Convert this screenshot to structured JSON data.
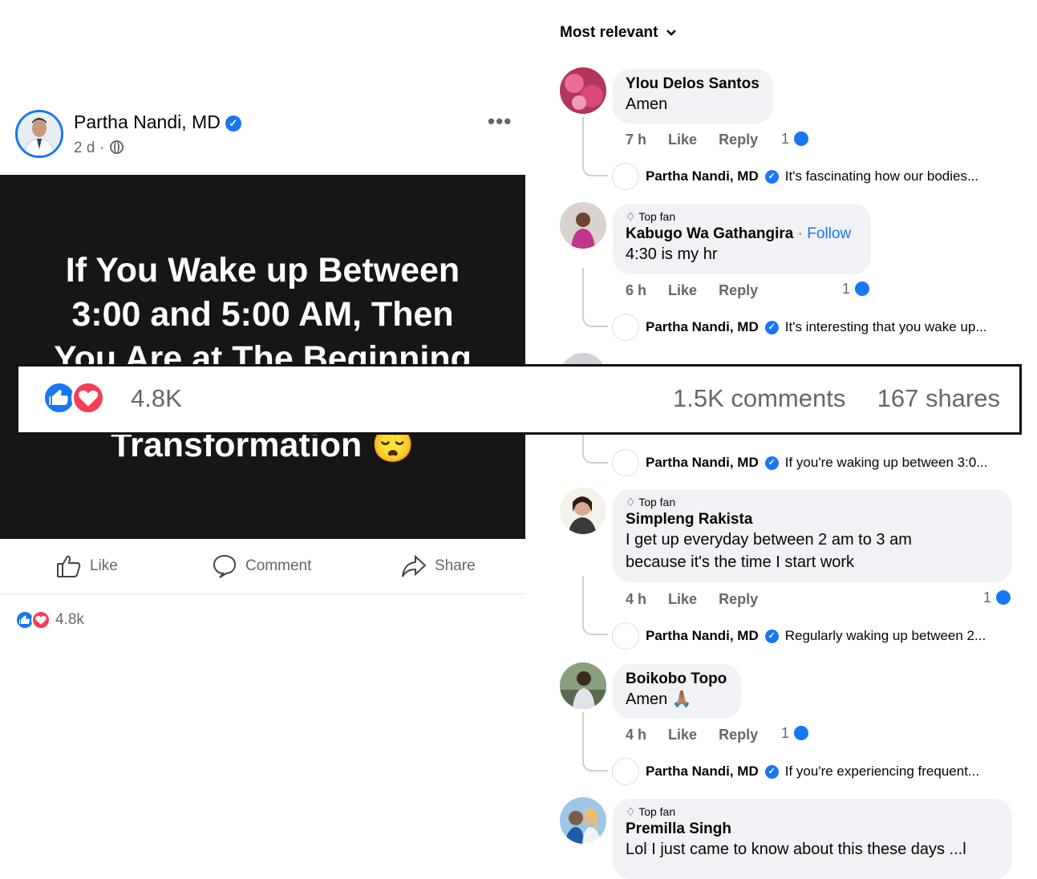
{
  "post": {
    "author": "Partha Nandi, MD",
    "time": "2 d ·",
    "more": "•••",
    "image_lines": [
      "If You Wake up Between",
      "3:00 and 5:00 AM, Then",
      "You Are at The Beginning",
      "Transformation 😴"
    ],
    "actions": {
      "like": "Like",
      "comment": "Comment",
      "share": "Share"
    },
    "reaction_count_small": "4.8k"
  },
  "stats_bar": {
    "reaction_count": "4.8K",
    "comments": "1.5K comments",
    "shares": "167 shares"
  },
  "comments": {
    "sort_label": "Most relevant",
    "items": [
      {
        "top_fan": "",
        "name": "Ylou Delos Santos",
        "follow": "",
        "text": "Amen",
        "time": "7 h",
        "like": "Like",
        "reply": "Reply",
        "count": "1",
        "reply_preview": {
          "name": "Partha Nandi, MD",
          "text": "It's fascinating how our bodies..."
        }
      },
      {
        "top_fan": "Top fan",
        "name": "Kabugo Wa Gathangira",
        "follow": "Follow",
        "text": "4:30 is my hr",
        "time": "6 h",
        "like": "Like",
        "reply": "Reply",
        "count": "1",
        "reply_preview": {
          "name": "Partha Nandi, MD",
          "text": "It's interesting that you wake up..."
        }
      },
      {
        "reply_preview": {
          "name": "Partha Nandi, MD",
          "text": "If you're waking up between 3:0..."
        }
      },
      {
        "top_fan": "Top fan",
        "name": "Simpleng Rakista",
        "follow": "",
        "text_lines": [
          "I get up everyday between 2 am to 3 am",
          "because it's the time I start work"
        ],
        "time": "4 h",
        "like": "Like",
        "reply": "Reply",
        "count": "1",
        "reply_preview": {
          "name": "Partha Nandi, MD",
          "text": "Regularly waking up between 2..."
        }
      },
      {
        "top_fan": "",
        "name": "Boikobo Topo",
        "follow": "",
        "text": "Amen 🙏🏽",
        "time": "4 h",
        "like": "Like",
        "reply": "Reply",
        "count": "1",
        "reply_preview": {
          "name": "Partha Nandi, MD",
          "text": "If you're experiencing frequent..."
        }
      },
      {
        "top_fan": "Top fan",
        "name": "Premilla Singh",
        "follow": "",
        "text": "Lol I just came to know about this  these days ...l"
      }
    ]
  },
  "colors": {
    "accent": "#1877f2",
    "love": "#f33e58",
    "bubble": "#f0f2f5",
    "muted": "#65676b"
  }
}
